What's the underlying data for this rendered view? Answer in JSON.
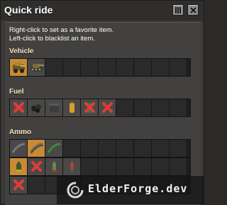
{
  "window": {
    "title": "Quick ride"
  },
  "hints": {
    "line1": "Right-click to set as a favorite item.",
    "line2": "Left-click to blacklist an item."
  },
  "sections": {
    "vehicle": {
      "label": "Vehicle"
    },
    "fuel": {
      "label": "Fuel"
    },
    "ammo": {
      "label": "Ammo"
    }
  },
  "watermark": {
    "text": "ElderForge.dev"
  },
  "colors": {
    "accent": "#c88a33",
    "blacklist": "#e03b3b"
  }
}
